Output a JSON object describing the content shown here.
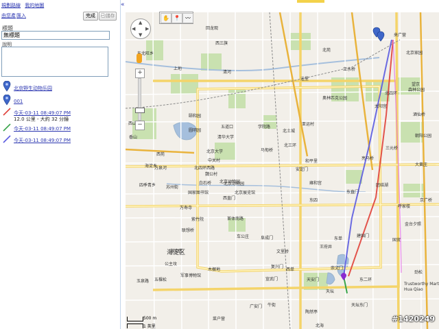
{
  "panel": {
    "links": [
      "規劃路線",
      "我的地圖"
    ],
    "collapse_icon": "«",
    "toolbar": {
      "create_label": "由您產",
      "import_label": "匯入",
      "done_label": "完成",
      "saved_label": "已儲存"
    },
    "title_label": "標題",
    "title_value": "無標題",
    "desc_label": "說明",
    "items": [
      {
        "kind": "marker",
        "color": "#3f67c9",
        "title": "北京野生动物乐园"
      },
      {
        "kind": "marker",
        "color": "#3f67c9",
        "title": "001"
      },
      {
        "kind": "line",
        "color": "#e0413a",
        "title": "今天-03-11 08:49:07 PM",
        "sub": "12.0 公里 - 大約 32 分鐘"
      },
      {
        "kind": "line",
        "color": "#39a34a",
        "title": "今天-03-11 08:49:07 PM"
      },
      {
        "kind": "line",
        "color": "#5b5be0",
        "title": "今天-03-11 08:49:07 PM"
      }
    ]
  },
  "map": {
    "tools": [
      "✋",
      "📍",
      "〰"
    ],
    "nav": {
      "up": "▲",
      "down": "▼",
      "left": "◀",
      "right": "▶"
    },
    "zoom": {
      "in": "+",
      "out": "−",
      "level": 0.8
    },
    "labels": [
      [
        "来广营",
        574,
        46
      ],
      [
        "北京家园",
        592,
        72
      ],
      [
        "太阳宫",
        546,
        150
      ],
      [
        "望京",
        600,
        118
      ],
      [
        "北四环",
        561,
        131
      ],
      [
        "森林公园",
        595,
        126
      ],
      [
        "酒仙桥",
        602,
        162
      ],
      [
        "朝阳公园",
        605,
        193
      ],
      [
        "三元桥",
        562,
        211
      ],
      [
        "大黄庄",
        605,
        235
      ],
      [
        "亮马桥",
        527,
        226
      ],
      [
        "团结湖",
        548,
        265
      ],
      [
        "京广桥",
        612,
        287
      ],
      [
        "呼家楼",
        580,
        296
      ],
      [
        "金台夕照",
        590,
        322
      ],
      [
        "国贸",
        572,
        345
      ],
      [
        "建国门",
        520,
        339
      ],
      [
        "东单",
        487,
        343
      ],
      [
        "王府井",
        466,
        355
      ],
      [
        "崇文门",
        482,
        386
      ],
      [
        "天坛",
        475,
        420
      ],
      [
        "北海",
        460,
        470
      ],
      [
        "东二环",
        524,
        403
      ],
      [
        "天坛东门",
        512,
        440
      ],
      [
        "劲松",
        604,
        392
      ],
      [
        "Trustworthy Mart",
        589,
        411
      ],
      [
        "Hua Qiao",
        589,
        419
      ],
      [
        "东四",
        451,
        287
      ],
      [
        "东直门",
        505,
        275
      ],
      [
        "雍和宫",
        451,
        262
      ],
      [
        "安定门",
        431,
        242
      ],
      [
        "北三环",
        414,
        207
      ],
      [
        "西直门",
        325,
        284
      ],
      [
        "北京动物园",
        326,
        263
      ],
      [
        "北京展览馆",
        342,
        276
      ],
      [
        "海淀区",
        248,
        361
      ],
      [
        "五道口",
        322,
        180
      ],
      [
        "学院路",
        376,
        180
      ],
      [
        "北京大学",
        301,
        216
      ],
      [
        "清华大学",
        317,
        195
      ],
      [
        "中关村",
        303,
        229
      ],
      [
        "万泉河",
        225,
        240
      ],
      [
        "北四环西路",
        283,
        240
      ],
      [
        "颐和园",
        275,
        164
      ],
      [
        "圆明园",
        275,
        185
      ],
      [
        "西苑",
        228,
        220
      ],
      [
        "海淀乡",
        211,
        237
      ],
      [
        "苏州街",
        242,
        268
      ],
      [
        "万寿寺",
        262,
        298
      ],
      [
        "紫竹院",
        279,
        315
      ],
      [
        "首体南路",
        331,
        314
      ],
      [
        "联想桥",
        265,
        331
      ],
      [
        "公主坟",
        240,
        380
      ],
      [
        "军事博物馆",
        263,
        397
      ],
      [
        "复兴门",
        395,
        384
      ],
      [
        "西单",
        417,
        388
      ],
      [
        "天安门",
        447,
        403
      ],
      [
        "文里桥",
        403,
        362
      ],
      [
        "车公庄",
        345,
        340
      ],
      [
        "阜成门",
        380,
        342
      ],
      [
        "上地",
        253,
        95
      ],
      [
        "西三旗",
        314,
        58
      ],
      [
        "清河",
        325,
        100
      ],
      [
        "回龙观",
        300,
        36
      ],
      [
        "北苑",
        470,
        68
      ],
      [
        "立水桥",
        500,
        96
      ],
      [
        "洼里",
        438,
        110
      ],
      [
        "奥林匹克公园",
        470,
        138
      ],
      [
        "亚运村",
        440,
        176
      ],
      [
        "北土城",
        412,
        186
      ],
      [
        "马甸桥",
        380,
        214
      ],
      [
        "和平里",
        445,
        230
      ],
      [
        "北京动物园",
        320,
        260
      ],
      [
        "白石桥",
        290,
        262
      ],
      [
        "国家图书馆",
        274,
        276
      ],
      [
        "魏公村",
        299,
        249
      ],
      [
        "东北旺乡",
        200,
        73
      ],
      [
        "西山",
        187,
        175
      ],
      [
        "香山",
        188,
        195
      ],
      [
        "四季青乡",
        203,
        265
      ],
      [
        "玉泉路",
        199,
        405
      ],
      [
        "五棵松",
        225,
        403
      ],
      [
        "木樨地",
        303,
        388
      ],
      [
        "广安门",
        364,
        442
      ],
      [
        "牛街",
        390,
        440
      ],
      [
        "陶然亭",
        445,
        450
      ],
      [
        "菜户营",
        310,
        460
      ],
      [
        "宣武门",
        387,
        402
      ]
    ],
    "big_labels": [
      [
        "海淀区",
        243,
        361
      ]
    ],
    "scale": {
      "top": "500 m",
      "bottom": "1 英里"
    },
    "watermark": "#1420249"
  }
}
